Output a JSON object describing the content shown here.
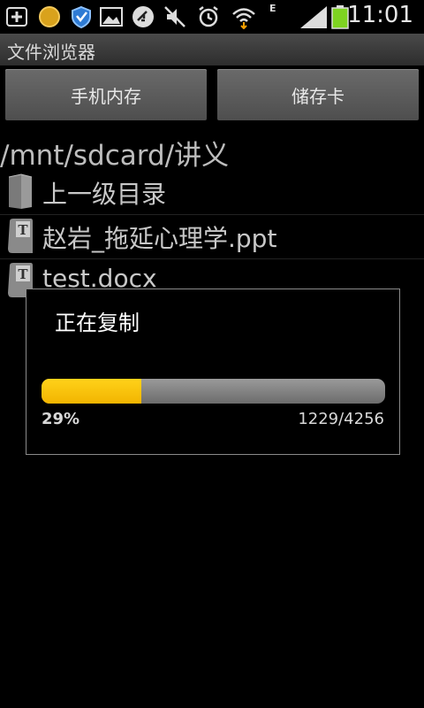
{
  "status_bar": {
    "time": "11:01",
    "network_type": "E",
    "icons": [
      "add-icon",
      "coin-icon",
      "shield-icon",
      "image-icon",
      "usb-icon",
      "mute-icon",
      "alarm-icon",
      "wifi-icon",
      "signal-icon",
      "battery-icon"
    ],
    "battery_color": "#7ed321"
  },
  "app": {
    "title": "文件浏览器"
  },
  "storage_buttons": {
    "phone_label": "手机内存",
    "sd_label": "储存卡"
  },
  "path": "/mnt/sdcard/讲义",
  "files": [
    {
      "label": "上一级目录",
      "icon": "folder-up-icon"
    },
    {
      "label": "赵岩_拖延心理学.ppt",
      "icon": "text-file-icon"
    },
    {
      "label": "test.docx",
      "icon": "text-file-icon"
    }
  ],
  "dialog": {
    "title": "正在复制",
    "percent_label": "29%",
    "progress_fraction": 0.29,
    "count_label": "1229/4256",
    "fill_color": "#f5bd00"
  }
}
